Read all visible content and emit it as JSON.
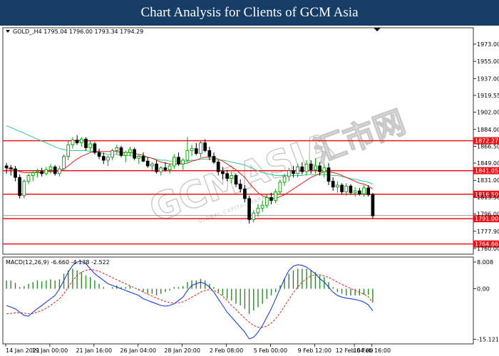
{
  "header": {
    "title": "Chart Analysis for Clients of GCM Asia"
  },
  "watermark": {
    "brand": "GCMASIA",
    "cn": "汇市网",
    "tagline": "GLOBAL CAPITAL MARKETS"
  },
  "colors": {
    "banner": "#163d66",
    "bull": "#00a000",
    "bear": "#000000",
    "ma_fast": "#e0201c",
    "ma_slow": "#2ecc8f",
    "level": "#e8161b",
    "macd_hist": "#2a8a2a",
    "macd_line": "#1c3fd6",
    "macd_signal": "#e0201c"
  },
  "chart_data": [
    {
      "type": "candlestick",
      "symbol_info": "GOLD_,H4  1795.04 1796.00 1793.34 1794.29",
      "y_ticks": [
        "1973.00",
        "1955.00",
        "1937.00",
        "1919.55",
        "1902.00",
        "1884.00",
        "1866.50",
        "1849.00",
        "1831.00",
        "1813.50",
        "1796.00",
        "1777.90",
        "1760.00"
      ],
      "ylim": [
        1754,
        1990
      ],
      "x_ticks": [
        "14 Jan 2021",
        "19 Jan 00:00",
        "21 Jan 16:00",
        "26 Jan 04:00",
        "28 Jan 20:00",
        "2 Feb 08:00",
        "5 Feb 00:00",
        "9 Feb 12:00",
        "12 Feb 04:00",
        "16 Feb 16:00"
      ],
      "current_price": "1794.29",
      "levels": [
        {
          "label": "1872.27",
          "value": 1872.27
        },
        {
          "label": "1841.05",
          "value": 1841.05
        },
        {
          "label": "1816.50",
          "value": 1816.5
        },
        {
          "label": "1791.00",
          "value": 1791.0
        },
        {
          "label": "1764.66",
          "value": 1764.66
        }
      ],
      "candles": [
        [
          1846,
          1849,
          1838,
          1844
        ],
        [
          1844,
          1847,
          1836,
          1843
        ],
        [
          1843,
          1846,
          1830,
          1834
        ],
        [
          1834,
          1837,
          1812,
          1815
        ],
        [
          1815,
          1832,
          1812,
          1830
        ],
        [
          1830,
          1838,
          1827,
          1836
        ],
        [
          1836,
          1841,
          1830,
          1839
        ],
        [
          1839,
          1843,
          1834,
          1840
        ],
        [
          1840,
          1844,
          1835,
          1838
        ],
        [
          1838,
          1845,
          1836,
          1842
        ],
        [
          1842,
          1848,
          1838,
          1845
        ],
        [
          1845,
          1847,
          1836,
          1838
        ],
        [
          1838,
          1846,
          1835,
          1843
        ],
        [
          1843,
          1858,
          1841,
          1856
        ],
        [
          1856,
          1872,
          1852,
          1868
        ],
        [
          1868,
          1876,
          1864,
          1873
        ],
        [
          1873,
          1878,
          1868,
          1870
        ],
        [
          1870,
          1876,
          1866,
          1874
        ],
        [
          1874,
          1876,
          1862,
          1865
        ],
        [
          1865,
          1872,
          1861,
          1869
        ],
        [
          1869,
          1871,
          1858,
          1860
        ],
        [
          1860,
          1864,
          1853,
          1856
        ],
        [
          1856,
          1860,
          1848,
          1852
        ],
        [
          1852,
          1857,
          1846,
          1855
        ],
        [
          1855,
          1864,
          1852,
          1862
        ],
        [
          1862,
          1868,
          1858,
          1865
        ],
        [
          1865,
          1867,
          1855,
          1857
        ],
        [
          1857,
          1862,
          1850,
          1860
        ],
        [
          1860,
          1866,
          1856,
          1863
        ],
        [
          1863,
          1865,
          1852,
          1854
        ],
        [
          1854,
          1858,
          1848,
          1856
        ],
        [
          1856,
          1860,
          1850,
          1851
        ],
        [
          1851,
          1855,
          1844,
          1846
        ],
        [
          1846,
          1850,
          1840,
          1848
        ],
        [
          1848,
          1852,
          1838,
          1840
        ],
        [
          1840,
          1846,
          1836,
          1844
        ],
        [
          1844,
          1850,
          1840,
          1842
        ],
        [
          1842,
          1848,
          1838,
          1846
        ],
        [
          1846,
          1858,
          1843,
          1855
        ],
        [
          1855,
          1860,
          1846,
          1848
        ],
        [
          1848,
          1854,
          1842,
          1852
        ],
        [
          1852,
          1876,
          1850,
          1862
        ],
        [
          1862,
          1868,
          1856,
          1864
        ],
        [
          1864,
          1870,
          1857,
          1859
        ],
        [
          1859,
          1873,
          1855,
          1870
        ],
        [
          1870,
          1874,
          1860,
          1862
        ],
        [
          1862,
          1866,
          1852,
          1856
        ],
        [
          1856,
          1860,
          1848,
          1850
        ],
        [
          1850,
          1852,
          1836,
          1840
        ],
        [
          1840,
          1845,
          1832,
          1838
        ],
        [
          1838,
          1842,
          1830,
          1833
        ],
        [
          1833,
          1840,
          1828,
          1836
        ],
        [
          1836,
          1838,
          1824,
          1827
        ],
        [
          1827,
          1832,
          1818,
          1822
        ],
        [
          1822,
          1826,
          1808,
          1812
        ],
        [
          1812,
          1815,
          1786,
          1790
        ],
        [
          1790,
          1800,
          1787,
          1797
        ],
        [
          1797,
          1806,
          1793,
          1802
        ],
        [
          1802,
          1810,
          1798,
          1805
        ],
        [
          1805,
          1816,
          1802,
          1813
        ],
        [
          1813,
          1818,
          1806,
          1810
        ],
        [
          1810,
          1822,
          1807,
          1819
        ],
        [
          1819,
          1832,
          1816,
          1829
        ],
        [
          1829,
          1838,
          1825,
          1835
        ],
        [
          1835,
          1844,
          1830,
          1841
        ],
        [
          1841,
          1846,
          1834,
          1838
        ],
        [
          1838,
          1848,
          1834,
          1845
        ],
        [
          1845,
          1850,
          1837,
          1840
        ],
        [
          1840,
          1852,
          1836,
          1848
        ],
        [
          1848,
          1852,
          1838,
          1842
        ],
        [
          1842,
          1854,
          1838,
          1846
        ],
        [
          1846,
          1850,
          1836,
          1840
        ],
        [
          1840,
          1848,
          1834,
          1844
        ],
        [
          1844,
          1849,
          1826,
          1830
        ],
        [
          1830,
          1834,
          1820,
          1824
        ],
        [
          1824,
          1830,
          1818,
          1826
        ],
        [
          1826,
          1828,
          1816,
          1819
        ],
        [
          1819,
          1828,
          1815,
          1825
        ],
        [
          1825,
          1827,
          1816,
          1818
        ],
        [
          1818,
          1824,
          1814,
          1820
        ],
        [
          1820,
          1823,
          1815,
          1817
        ],
        [
          1817,
          1826,
          1814,
          1823
        ],
        [
          1823,
          1826,
          1814,
          1816
        ],
        [
          1816,
          1818,
          1791,
          1794
        ]
      ],
      "ma_fast": [
        1843,
        1843,
        1842,
        1840,
        1839,
        1839,
        1839,
        1839,
        1839,
        1840,
        1840,
        1840,
        1841,
        1843,
        1846,
        1850,
        1853,
        1856,
        1858,
        1860,
        1861,
        1861,
        1861,
        1861,
        1861,
        1861,
        1860,
        1860,
        1860,
        1859,
        1858,
        1857,
        1855,
        1854,
        1852,
        1850,
        1849,
        1848,
        1848,
        1848,
        1848,
        1849,
        1851,
        1852,
        1854,
        1855,
        1855,
        1855,
        1853,
        1851,
        1848,
        1845,
        1842,
        1838,
        1834,
        1828,
        1823,
        1818,
        1815,
        1813,
        1812,
        1812,
        1814,
        1816,
        1819,
        1822,
        1825,
        1828,
        1831,
        1834,
        1836,
        1838,
        1840,
        1840,
        1839,
        1838,
        1836,
        1834,
        1832,
        1830,
        1828,
        1827,
        1825,
        1822
      ],
      "ma_slow": [
        1888,
        1886,
        1884,
        1882,
        1880,
        1878,
        1876,
        1874,
        1872,
        1870,
        1868,
        1866,
        1864,
        1863,
        1862,
        1862,
        1862,
        1862,
        1862,
        1861,
        1861,
        1860,
        1859,
        1858,
        1858,
        1858,
        1857,
        1857,
        1857,
        1856,
        1856,
        1855,
        1855,
        1854,
        1853,
        1852,
        1852,
        1851,
        1851,
        1851,
        1851,
        1851,
        1852,
        1852,
        1853,
        1853,
        1853,
        1853,
        1852,
        1852,
        1851,
        1850,
        1849,
        1848,
        1847,
        1845,
        1843,
        1841,
        1839,
        1838,
        1837,
        1836,
        1836,
        1836,
        1836,
        1836,
        1836,
        1836,
        1837,
        1837,
        1837,
        1837,
        1837,
        1837,
        1836,
        1836,
        1835,
        1834,
        1833,
        1832,
        1831,
        1830,
        1829,
        1827
      ]
    },
    {
      "type": "macd",
      "title": "MACD(12,26,9) -6.660 -4.138 -2.522",
      "y_ticks": [
        "8.008",
        "0.00",
        "-15.121"
      ],
      "ylim": [
        -16.5,
        9.5
      ],
      "hist": [
        2.5,
        2.5,
        1.8,
        0.5,
        0.8,
        1.5,
        2,
        2.5,
        2.2,
        2.5,
        2.8,
        2.5,
        2.8,
        4.5,
        5.5,
        6,
        5.5,
        5,
        4,
        3.5,
        2.5,
        1.5,
        0.5,
        0,
        0.5,
        1,
        0.5,
        0.5,
        0.8,
        0,
        -0.5,
        -1,
        -1.5,
        -1.5,
        -2,
        -1.5,
        -1,
        -0.5,
        0.5,
        0.5,
        0.8,
        2,
        2.5,
        2.5,
        3,
        2.5,
        1.5,
        0.5,
        -1,
        -2,
        -3,
        -3.5,
        -4.5,
        -5,
        -6,
        -7.5,
        -6.5,
        -5.5,
        -4.5,
        -3,
        -2,
        -1,
        1,
        3,
        4.5,
        5.5,
        6,
        6,
        6,
        5.5,
        5,
        4,
        3.5,
        2,
        0.5,
        -1,
        -1.5,
        -2,
        -2,
        -2,
        -2,
        -1.8,
        -1.8,
        -4
      ],
      "macd": [
        -5,
        -5.5,
        -6,
        -7,
        -8,
        -8.2,
        -7,
        -6,
        -5,
        -4,
        -3,
        -2,
        0,
        2.5,
        5,
        7,
        8,
        8.2,
        7.5,
        6,
        4.5,
        3.5,
        2.5,
        1.5,
        1,
        0.5,
        0,
        -0.5,
        -1,
        -1.5,
        -2,
        -3,
        -3.5,
        -4,
        -4.5,
        -5,
        -5.2,
        -5,
        -4.5,
        -3.5,
        -2.5,
        -0.5,
        1,
        1.5,
        2,
        1.5,
        0.5,
        -1,
        -3,
        -5,
        -7,
        -8.5,
        -10,
        -11.5,
        -13,
        -15,
        -14.5,
        -13,
        -11,
        -8.5,
        -6,
        -3,
        0,
        3,
        5.5,
        6.8,
        7.2,
        7,
        6.5,
        5.5,
        4.5,
        3,
        2,
        0.5,
        -1,
        -2,
        -2.5,
        -2.8,
        -3,
        -3.2,
        -3.5,
        -4,
        -4.8,
        -6.6
      ],
      "signal": [
        -7.5,
        -7.4,
        -7.2,
        -7.2,
        -7.3,
        -7.5,
        -7.4,
        -7,
        -6.5,
        -5.8,
        -5,
        -4,
        -3,
        -1.5,
        0.5,
        2.5,
        4,
        5,
        5.5,
        5.8,
        5.6,
        5.2,
        4.6,
        4,
        3.3,
        2.7,
        2.1,
        1.5,
        0.9,
        0.3,
        -0.3,
        -1,
        -1.6,
        -2.2,
        -2.8,
        -3.3,
        -3.8,
        -4.1,
        -4.3,
        -4.2,
        -3.9,
        -3.3,
        -2.5,
        -1.8,
        -1,
        -0.5,
        -0.3,
        -0.5,
        -1.2,
        -2.2,
        -3.5,
        -5,
        -6.2,
        -7.5,
        -8.8,
        -10,
        -11,
        -11.5,
        -11.6,
        -11.2,
        -10.3,
        -9,
        -7.2,
        -5.2,
        -3.2,
        -1.2,
        0.5,
        2,
        3,
        3.8,
        4.2,
        4.2,
        3.9,
        3.4,
        2.7,
        2,
        1.3,
        0.7,
        0.1,
        -0.5,
        -1,
        -1.6,
        -2.4,
        -4.1
      ]
    }
  ]
}
